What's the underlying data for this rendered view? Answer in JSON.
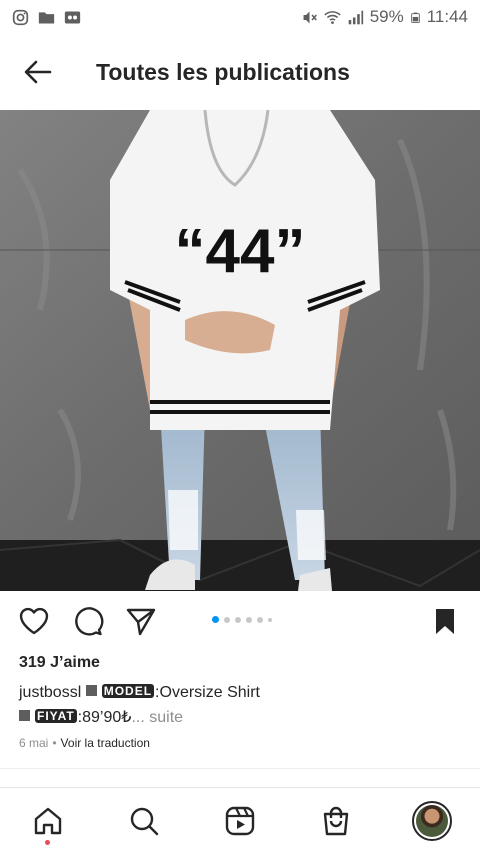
{
  "status_bar": {
    "battery_percent": "59%",
    "time": "11:44",
    "icons": [
      "instagram-icon",
      "folder-icon",
      "voicemail-icon",
      "mute-icon",
      "wifi-icon",
      "signal-icon",
      "battery-icon"
    ]
  },
  "header": {
    "title": "Toutes les publications"
  },
  "post": {
    "image_subject": "",
    "shirt_number": "“44”",
    "carousel": {
      "total": 6,
      "active_index": 0
    },
    "likes": "319 J’aime",
    "username": "justbossl",
    "caption_label1": "MODEL",
    "caption_text1": ":Oversize Shirt",
    "caption_label2": "FIYAT",
    "caption_text2": ":89’90₺",
    "more": "... suite",
    "date": "6 mai",
    "separator": "•",
    "translate": "Voir la traduction"
  },
  "colors": {
    "accent_blue": "#0095f6",
    "text": "#262626",
    "muted": "#8e8e8e",
    "notification": "#ed4956"
  }
}
